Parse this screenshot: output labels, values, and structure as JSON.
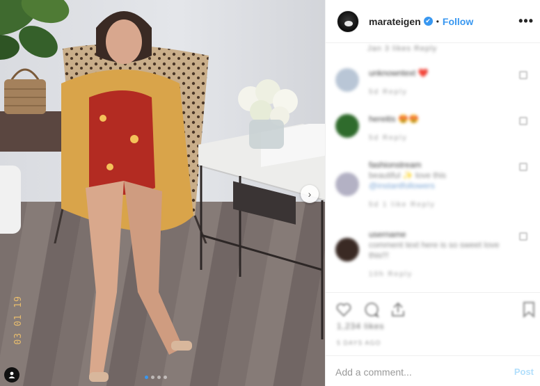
{
  "post": {
    "image_stamp": "03 01 19",
    "carousel": {
      "total": 4,
      "active": 0
    },
    "next_icon": "chevron-right-icon",
    "tag_icon": "person-tag-icon"
  },
  "header": {
    "username": "marateigen",
    "verified_mark": "✔",
    "separator": "•",
    "follow_label": "Follow",
    "more_label": "•••"
  },
  "comments": {
    "top_meta": "Jan  3 likes  Reply",
    "items": [
      {
        "name": "unknowntext ❤️",
        "text": "",
        "link": "",
        "meta": "5d  Reply",
        "avatar_color": "#b9c6d6"
      },
      {
        "name": "hereitis 😍😍",
        "text": "",
        "link": "",
        "meta": "5d  Reply",
        "avatar_color": "#2f6b2c"
      },
      {
        "name": "fashionstream",
        "text": "beautiful ✨ love this",
        "link": "@instantfollowers",
        "meta": "5d  1 like  Reply",
        "avatar_color": "#b3b1c4"
      },
      {
        "name": "username",
        "text": "comment text here is so sweet love this!!!",
        "link": "",
        "meta": "10h  Reply",
        "avatar_color": "#3a2a24"
      }
    ]
  },
  "actions": {
    "like_icon": "heart-icon",
    "comment_icon": "comment-icon",
    "share_icon": "share-icon",
    "save_icon": "bookmark-icon",
    "likes_text": "1,234 likes",
    "date_text": "5 DAYS AGO"
  },
  "add_comment": {
    "placeholder": "Add a comment...",
    "post_label": "Post"
  },
  "colors": {
    "accent": "#3897f0",
    "post_disabled": "#b2dffc",
    "border": "#efefef"
  }
}
